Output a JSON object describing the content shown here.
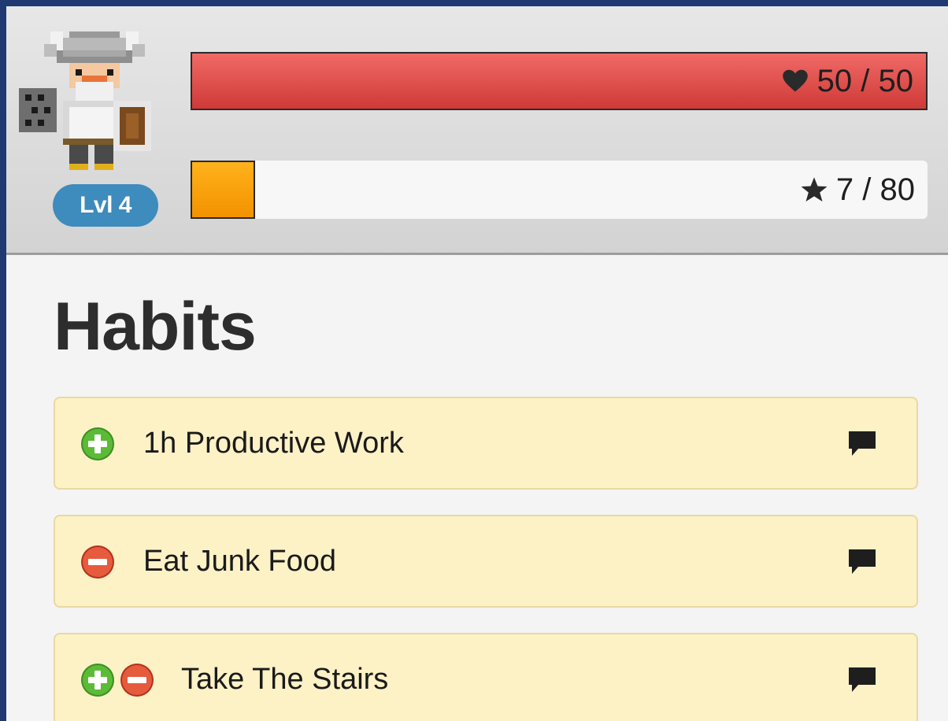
{
  "colors": {
    "background": "#1f3a73",
    "hp": "#d94542",
    "xp": "#f7a10d",
    "level_badge": "#3e8bbd",
    "habit_card": "#fdf1c6",
    "plus_button": "#4aa82a",
    "minus_button": "#d9452b"
  },
  "avatar": {
    "icon": "viking-warrior-avatar"
  },
  "stats": {
    "level_label": "Lvl 4",
    "hp": {
      "icon": "heart-icon",
      "text": "50 / 50",
      "current": 50,
      "max": 50,
      "fraction": 1.0
    },
    "xp": {
      "icon": "star-icon",
      "text": "7 / 80",
      "current": 7,
      "max": 80,
      "fraction": 0.0875
    }
  },
  "section": {
    "title": "Habits"
  },
  "habits": [
    {
      "label": "1h Productive Work",
      "buttons": [
        "plus"
      ]
    },
    {
      "label": "Eat Junk Food",
      "buttons": [
        "minus"
      ]
    },
    {
      "label": "Take The Stairs",
      "buttons": [
        "plus",
        "minus"
      ]
    }
  ]
}
